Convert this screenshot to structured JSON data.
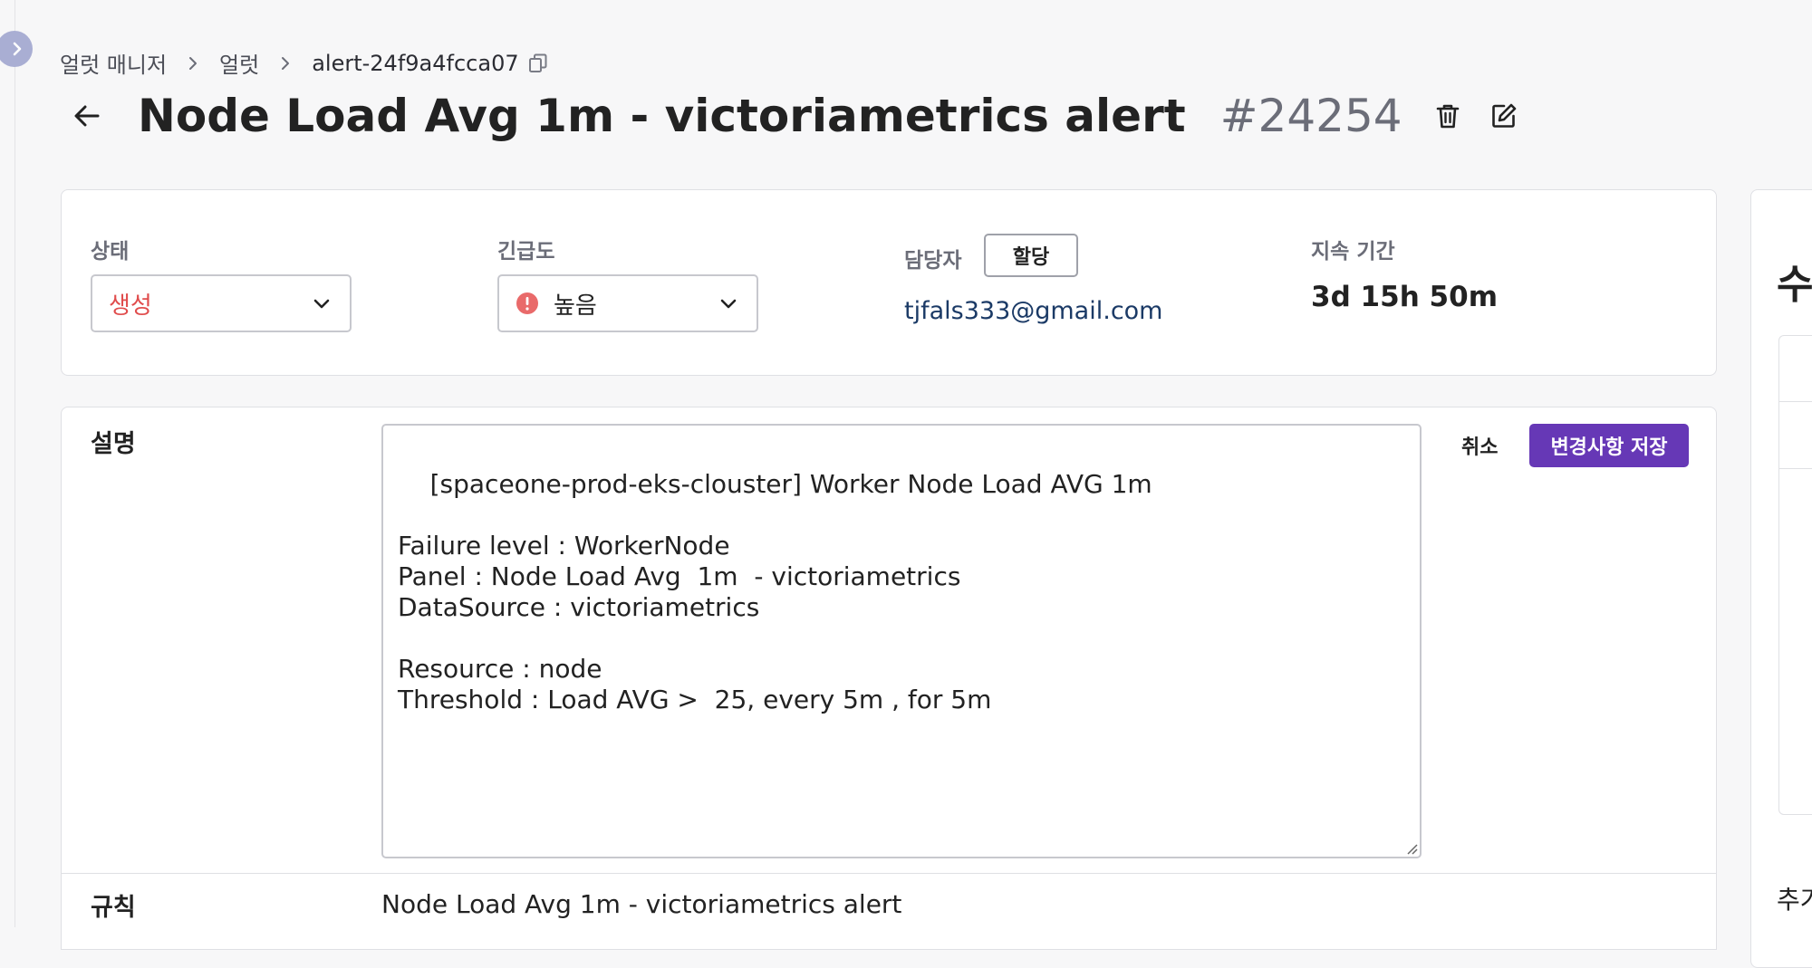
{
  "breadcrumb": {
    "items": [
      "얼럿 매니저",
      "얼럿"
    ],
    "current": "alert-24f9a4fcca07"
  },
  "header": {
    "title": "Node Load Avg 1m - victoriametrics alert",
    "number": "#24254"
  },
  "info": {
    "status_label": "상태",
    "status_value": "생성",
    "urgency_label": "긴급도",
    "urgency_value": "높음",
    "assignee_label": "담당자",
    "assign_button": "할당",
    "assignee_value": "tjfals333@gmail.com",
    "duration_label": "지속 기간",
    "duration_value": "3d 15h 50m"
  },
  "description": {
    "label": "설명",
    "text": "[spaceone-prod-eks-clouster] Worker Node Load AVG 1m\n\nFailure level : WorkerNode\nPanel : Node Load Avg  1m  - victoriametrics\nDataSource : victoriametrics\n\nResource : node\nThreshold : Load AVG >  25, every 5m , for 5m",
    "cancel_label": "취소",
    "save_label": "변경사항 저장"
  },
  "rule": {
    "label": "규칙",
    "value": "Node Load Avg 1m - victoriametrics alert"
  },
  "right_panel": {
    "heading": "수",
    "footer": "추가"
  },
  "colors": {
    "accent": "#6638b6",
    "status_red": "#e04c4c",
    "link_navy": "#1b3a66",
    "urgency_icon": "#e96a6a"
  },
  "icons": {
    "expand": "chevron-right-icon",
    "separator": "chevron-right-icon",
    "copy": "copy-icon",
    "back": "arrow-left-icon",
    "delete": "trash-icon",
    "edit": "edit-icon",
    "dropdown": "chevron-down-icon",
    "urgency": "alert-circle-icon"
  }
}
